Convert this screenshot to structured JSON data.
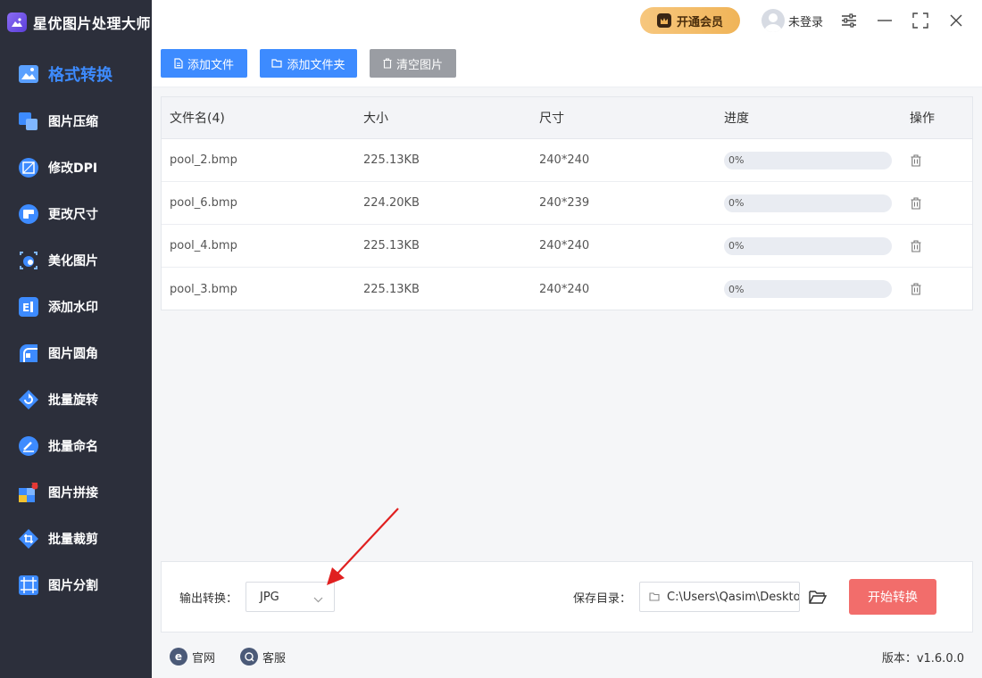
{
  "app": {
    "title": "星优图片处理大师"
  },
  "sidebar": {
    "items": [
      {
        "label": "格式转换",
        "icon": "image-convert-icon",
        "active": true
      },
      {
        "label": "图片压缩",
        "icon": "compress-icon"
      },
      {
        "label": "修改DPI",
        "icon": "dpi-icon"
      },
      {
        "label": "更改尺寸",
        "icon": "resize-icon"
      },
      {
        "label": "美化图片",
        "icon": "beautify-icon"
      },
      {
        "label": "添加水印",
        "icon": "watermark-icon"
      },
      {
        "label": "图片圆角",
        "icon": "rounded-corner-icon"
      },
      {
        "label": "批量旋转",
        "icon": "rotate-icon"
      },
      {
        "label": "批量命名",
        "icon": "rename-icon"
      },
      {
        "label": "图片拼接",
        "icon": "stitch-icon"
      },
      {
        "label": "批量裁剪",
        "icon": "crop-icon"
      },
      {
        "label": "图片分割",
        "icon": "split-icon"
      }
    ]
  },
  "header": {
    "vip_label": "开通会员",
    "user_label": "未登录"
  },
  "toolbar": {
    "add_file": "添加文件",
    "add_folder": "添加文件夹",
    "clear": "清空图片"
  },
  "table": {
    "headers": [
      "文件名(4)",
      "大小",
      "尺寸",
      "进度",
      "操作"
    ],
    "rows": [
      {
        "name": "pool_2.bmp",
        "size": "225.13KB",
        "dims": "240*240",
        "progress": "0%"
      },
      {
        "name": "pool_6.bmp",
        "size": "224.20KB",
        "dims": "240*239",
        "progress": "0%"
      },
      {
        "name": "pool_4.bmp",
        "size": "225.13KB",
        "dims": "240*240",
        "progress": "0%"
      },
      {
        "name": "pool_3.bmp",
        "size": "225.13KB",
        "dims": "240*240",
        "progress": "0%"
      }
    ]
  },
  "output": {
    "format_label": "输出转换：",
    "format_value": "JPG",
    "save_label": "保存目录：",
    "save_path": "C:\\Users\\Qasim\\Desktop",
    "start_label": "开始转换"
  },
  "footer": {
    "website": "官网",
    "support": "客服",
    "version": "版本：v1.6.0.0"
  },
  "colors": {
    "accent": "#3d8bff",
    "sidebar_bg": "#2c2f3b",
    "start_button": "#f26d6b",
    "clear_button": "#9a9da3",
    "vip_gold": "#f0b458",
    "annotation_arrow": "#e02020"
  }
}
